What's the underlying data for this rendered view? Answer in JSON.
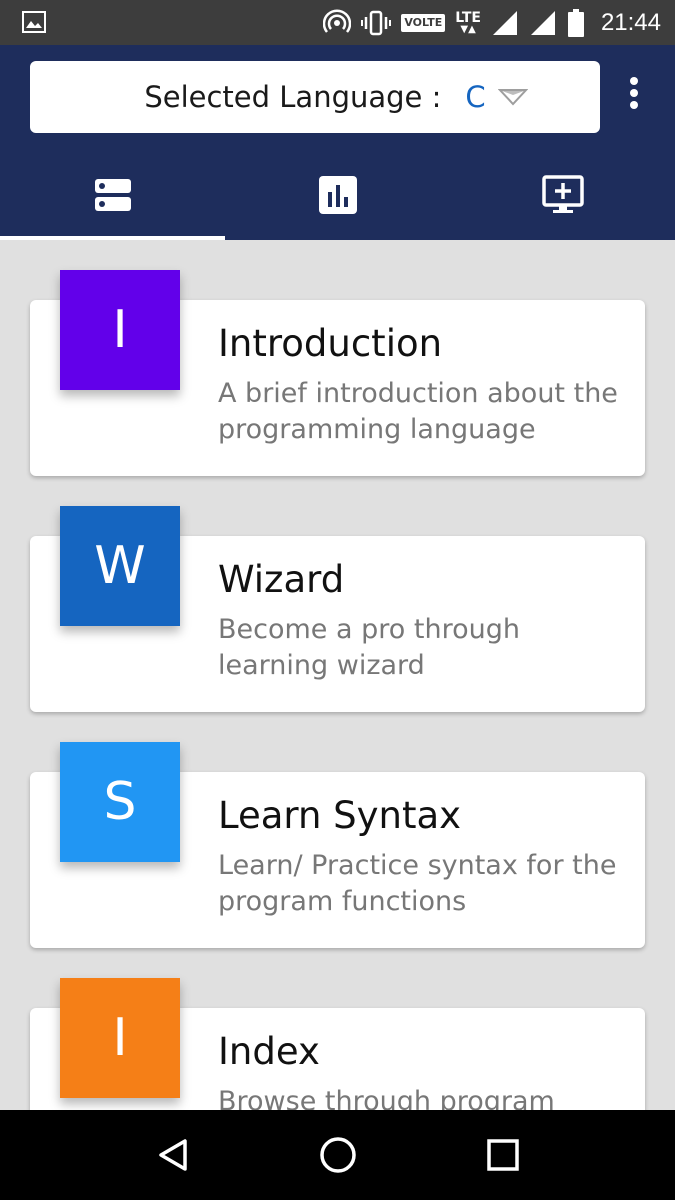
{
  "status_bar": {
    "volte": "VOLTE",
    "lte": "LTE",
    "time": "21:44"
  },
  "header": {
    "selector_label": "Selected Language :",
    "selector_value": "C"
  },
  "tabs": [
    {
      "icon": "list-icon"
    },
    {
      "icon": "bar-chart-icon"
    },
    {
      "icon": "add-screen-icon"
    }
  ],
  "cards": [
    {
      "badge": "I",
      "title": "Introduction",
      "description": "A brief introduction about the programming language",
      "color": "#6200ea"
    },
    {
      "badge": "W",
      "title": "Wizard",
      "description": "Become a pro through learning wizard",
      "color": "#1565c0"
    },
    {
      "badge": "S",
      "title": "Learn Syntax",
      "description": "Learn/ Practice syntax for the program functions",
      "color": "#2196f3"
    },
    {
      "badge": "I",
      "title": "Index",
      "description": "Browse through program",
      "color": "#f57f17"
    }
  ],
  "colors": {
    "header_bg": "#1e2d5c",
    "content_bg": "#e0e0e0",
    "accent": "#1565c0"
  }
}
